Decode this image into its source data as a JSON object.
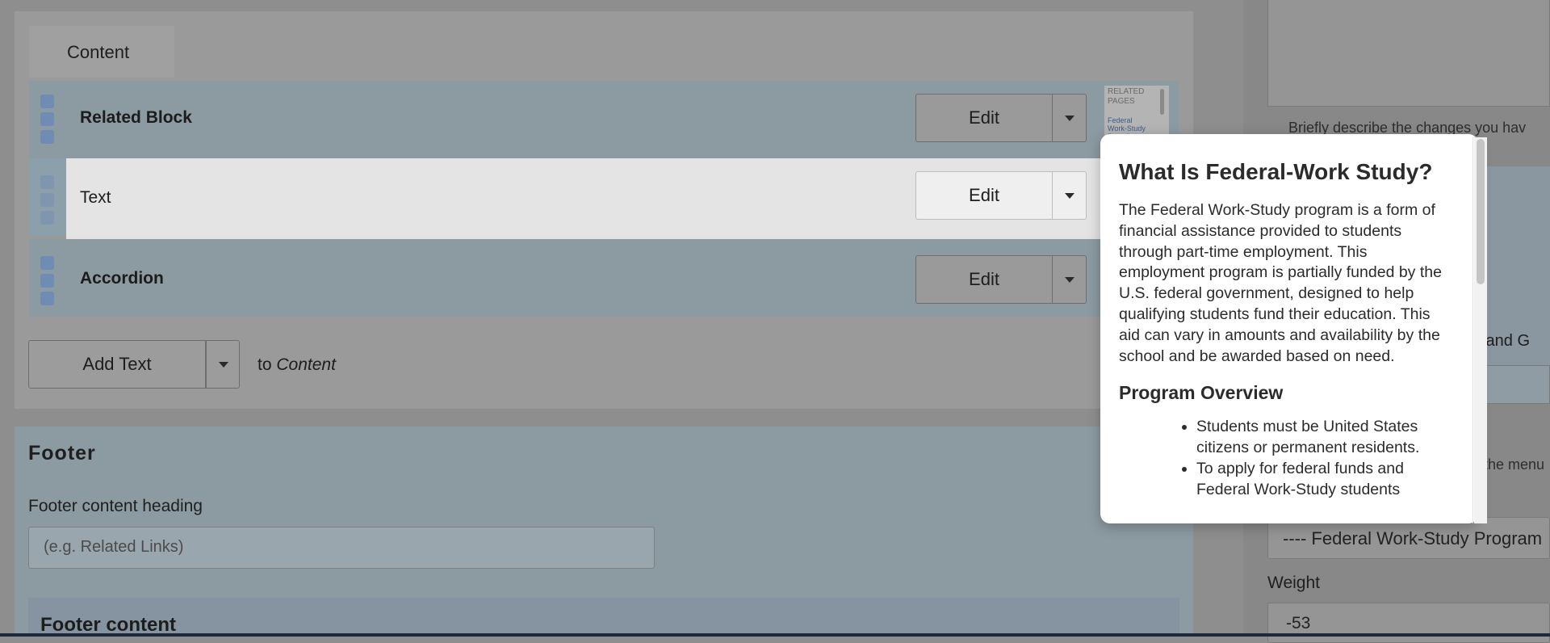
{
  "content_tab": {
    "label": "Content"
  },
  "rows": [
    {
      "label": "Related Block",
      "edit_label": "Edit"
    },
    {
      "label": "Text",
      "edit_label": "Edit"
    },
    {
      "label": "Accordion",
      "edit_label": "Edit"
    }
  ],
  "thumbnail": {
    "heading": "RELATED PAGES",
    "link": "Federal Work-Study Payroll"
  },
  "add": {
    "button_label": "Add Text",
    "to_prefix": "to",
    "target": "Content"
  },
  "footer": {
    "title": "Footer",
    "heading_label": "Footer content heading",
    "heading_placeholder": "(e.g. Related Links)",
    "content_label": "Footer content"
  },
  "sidebar": {
    "revision_hint": "Briefly describe the changes you hav",
    "title_fragment": "s and G",
    "menu_hint": "the menu",
    "parent_value": "---- Federal Work-Study Program",
    "weight_label": "Weight",
    "weight_value": "-53"
  },
  "preview": {
    "title": "What Is Federal-Work Study?",
    "paragraph": "The Federal Work-Study program is a form of financial assistance provided to students through part-time employment. This employment program is partially funded by the U.S. federal government, designed to help qualifying students fund their education. This aid can vary in amounts and availability by the school and be awarded based on need.",
    "subheading": "Program Overview",
    "bullets": [
      "Students must be United States citizens or permanent residents.",
      "To apply for federal funds and Federal Work-Study students"
    ]
  },
  "colors": {
    "overlay_gray": "#9a9a9a",
    "row_blue": "#8c9aa2",
    "handle_blue": "#6f8cb4",
    "active_row": "#e4e4e4",
    "popup_bg": "#ffffff",
    "bottom_bar": "#1e2a3a"
  }
}
